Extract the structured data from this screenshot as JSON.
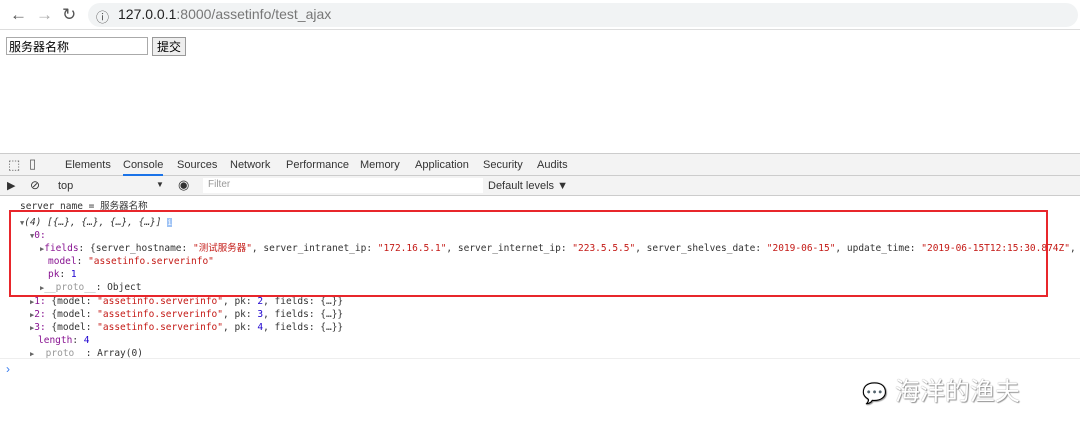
{
  "browser": {
    "url_host": "127.0.0.1",
    "url_rest": ":8000/assetinfo/test_ajax"
  },
  "page": {
    "input_value": "服务器名称",
    "submit_label": "提交"
  },
  "devtools": {
    "tabs": [
      "Elements",
      "Console",
      "Sources",
      "Network",
      "Performance",
      "Memory",
      "Application",
      "Security",
      "Audits"
    ],
    "active_tab": "Console",
    "context": "top",
    "filter_placeholder": "Filter",
    "levels": "Default levels ▼"
  },
  "console": {
    "log": "server_name = 服务器名称",
    "array_summary": "(4) [{…}, {…}, {…}, {…}]",
    "item0_key": "0:",
    "fields_key": "fields",
    "fields_parts": [
      {
        "k": "server_hostname",
        "v": "\"测试服务器\""
      },
      {
        "k": "server_intranet_ip",
        "v": "\"172.16.5.1\""
      },
      {
        "k": "server_internet_ip",
        "v": "\"223.5.5.5\""
      },
      {
        "k": "server_shelves_date",
        "v": "\"2019-06-15\""
      },
      {
        "k": "update_time",
        "v": "\"2019-06-15T12:15:30.874Z\""
      }
    ],
    "model": "\"assetinfo.serverinfo\"",
    "pk": "1",
    "proto_obj": "Object",
    "items": [
      {
        "idx": "1",
        "model": "\"assetinfo.serverinfo\"",
        "pk": "2"
      },
      {
        "idx": "2",
        "model": "\"assetinfo.serverinfo\"",
        "pk": "3"
      },
      {
        "idx": "3",
        "model": "\"assetinfo.serverinfo\"",
        "pk": "4"
      }
    ],
    "length": "4",
    "proto_arr": "Array(0)"
  },
  "watermark": "海洋的渔夫"
}
